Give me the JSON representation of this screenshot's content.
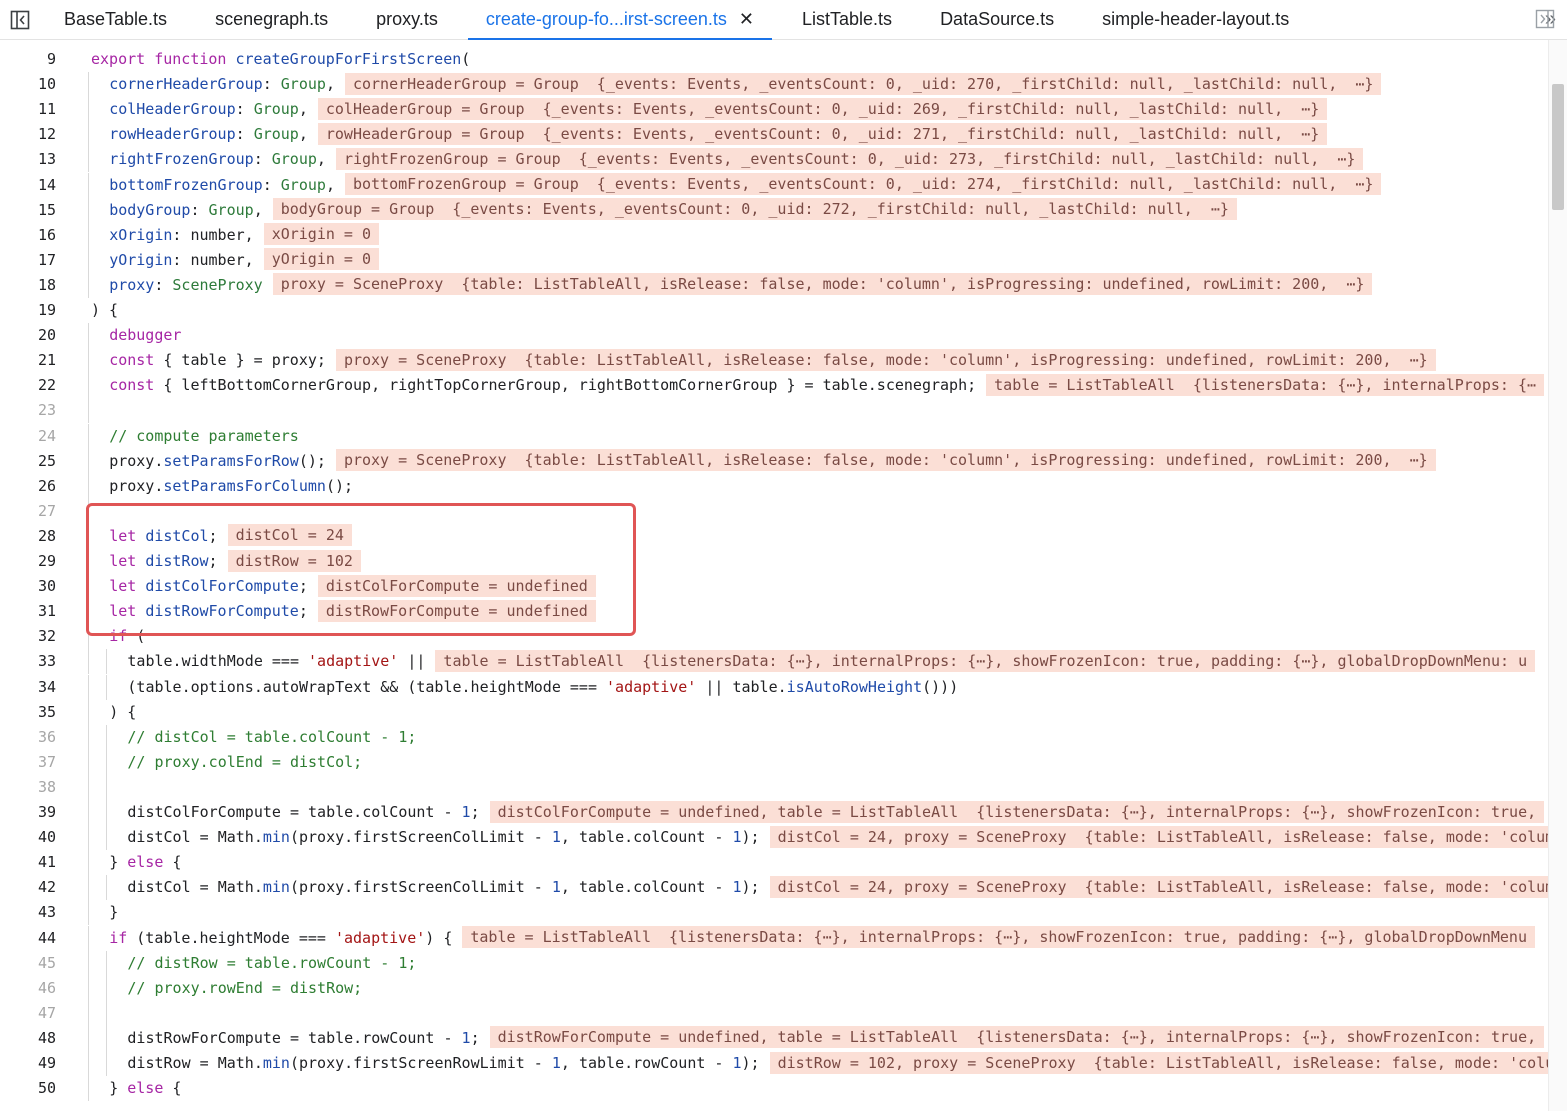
{
  "tabs": [
    {
      "label": "BaseTable.ts",
      "active": false
    },
    {
      "label": "scenegraph.ts",
      "active": false
    },
    {
      "label": "proxy.ts",
      "active": false
    },
    {
      "label": "create-group-fo...irst-screen.ts",
      "active": true
    },
    {
      "label": "ListTable.ts",
      "active": false
    },
    {
      "label": "DataSource.ts",
      "active": false
    },
    {
      "label": "simple-header-layout.ts",
      "active": false
    }
  ],
  "tab_close_glyph": "✕",
  "more_tabs_glyph": "»",
  "colors": {
    "accent": "#1a73e8",
    "inline_value_bg": "#fbdfd6",
    "highlight_box": "#e05555"
  },
  "lines": [
    {
      "n": "9",
      "indent": 0,
      "tokens": [
        [
          "kw",
          "export "
        ],
        [
          "kw",
          "function "
        ],
        [
          "fn",
          "createGroupForFirstScreen"
        ],
        [
          "plain",
          "("
        ]
      ],
      "inline": ""
    },
    {
      "n": "10",
      "indent": 1,
      "tokens": [
        [
          "prop",
          "cornerHeaderGroup"
        ],
        [
          "plain",
          ": "
        ],
        [
          "typ",
          "Group"
        ],
        [
          "plain",
          ","
        ]
      ],
      "inline": "cornerHeaderGroup = Group  {_events: Events, _eventsCount: 0, _uid: 270, _firstChild: null, _lastChild: null,  ⋯}"
    },
    {
      "n": "11",
      "indent": 1,
      "tokens": [
        [
          "prop",
          "colHeaderGroup"
        ],
        [
          "plain",
          ": "
        ],
        [
          "typ",
          "Group"
        ],
        [
          "plain",
          ","
        ]
      ],
      "inline": "colHeaderGroup = Group  {_events: Events, _eventsCount: 0, _uid: 269, _firstChild: null, _lastChild: null,  ⋯}"
    },
    {
      "n": "12",
      "indent": 1,
      "tokens": [
        [
          "prop",
          "rowHeaderGroup"
        ],
        [
          "plain",
          ": "
        ],
        [
          "typ",
          "Group"
        ],
        [
          "plain",
          ","
        ]
      ],
      "inline": "rowHeaderGroup = Group  {_events: Events, _eventsCount: 0, _uid: 271, _firstChild: null, _lastChild: null,  ⋯}"
    },
    {
      "n": "13",
      "indent": 1,
      "tokens": [
        [
          "prop",
          "rightFrozenGroup"
        ],
        [
          "plain",
          ": "
        ],
        [
          "typ",
          "Group"
        ],
        [
          "plain",
          ","
        ]
      ],
      "inline": "rightFrozenGroup = Group  {_events: Events, _eventsCount: 0, _uid: 273, _firstChild: null, _lastChild: null,  ⋯}"
    },
    {
      "n": "14",
      "indent": 1,
      "tokens": [
        [
          "prop",
          "bottomFrozenGroup"
        ],
        [
          "plain",
          ": "
        ],
        [
          "typ",
          "Group"
        ],
        [
          "plain",
          ","
        ]
      ],
      "inline": "bottomFrozenGroup = Group  {_events: Events, _eventsCount: 0, _uid: 274, _firstChild: null, _lastChild: null,  ⋯}"
    },
    {
      "n": "15",
      "indent": 1,
      "tokens": [
        [
          "prop",
          "bodyGroup"
        ],
        [
          "plain",
          ": "
        ],
        [
          "typ",
          "Group"
        ],
        [
          "plain",
          ","
        ]
      ],
      "inline": "bodyGroup = Group  {_events: Events, _eventsCount: 0, _uid: 272, _firstChild: null, _lastChild: null,  ⋯}"
    },
    {
      "n": "16",
      "indent": 1,
      "tokens": [
        [
          "prop",
          "xOrigin"
        ],
        [
          "plain",
          ": number,"
        ]
      ],
      "inline": "xOrigin = 0"
    },
    {
      "n": "17",
      "indent": 1,
      "tokens": [
        [
          "prop",
          "yOrigin"
        ],
        [
          "plain",
          ": number,"
        ]
      ],
      "inline": "yOrigin = 0"
    },
    {
      "n": "18",
      "indent": 1,
      "tokens": [
        [
          "prop",
          "proxy"
        ],
        [
          "plain",
          ": "
        ],
        [
          "typ",
          "SceneProxy"
        ]
      ],
      "inline": "proxy = SceneProxy  {table: ListTableAll, isRelease: false, mode: 'column', isProgressing: undefined, rowLimit: 200,  ⋯}"
    },
    {
      "n": "19",
      "indent": 0,
      "tokens": [
        [
          "plain",
          ") {"
        ]
      ],
      "inline": ""
    },
    {
      "n": "20",
      "indent": 1,
      "tokens": [
        [
          "kw",
          "debugger"
        ]
      ],
      "inline": ""
    },
    {
      "n": "21",
      "indent": 1,
      "tokens": [
        [
          "kw",
          "const "
        ],
        [
          "plain",
          "{ table } = proxy;"
        ]
      ],
      "inline": "proxy = SceneProxy  {table: ListTableAll, isRelease: false, mode: 'column', isProgressing: undefined, rowLimit: 200,  ⋯}"
    },
    {
      "n": "22",
      "indent": 1,
      "tokens": [
        [
          "kw",
          "const "
        ],
        [
          "plain",
          "{ leftBottomCornerGroup, rightTopCornerGroup, rightBottomCornerGroup } = table.scenegraph;"
        ]
      ],
      "inline": "table = ListTableAll  {listenersData: {⋯}, internalProps: {⋯"
    },
    {
      "n": "23",
      "indent": 1,
      "tokens": [],
      "inline": ""
    },
    {
      "n": "24",
      "indent": 1,
      "tokens": [
        [
          "cmt",
          "// compute parameters"
        ]
      ],
      "inline": ""
    },
    {
      "n": "25",
      "indent": 1,
      "tokens": [
        [
          "plain",
          "proxy."
        ],
        [
          "fn",
          "setParamsForRow"
        ],
        [
          "plain",
          "();"
        ]
      ],
      "inline": "proxy = SceneProxy  {table: ListTableAll, isRelease: false, mode: 'column', isProgressing: undefined, rowLimit: 200,  ⋯}"
    },
    {
      "n": "26",
      "indent": 1,
      "tokens": [
        [
          "plain",
          "proxy."
        ],
        [
          "fn",
          "setParamsForColumn"
        ],
        [
          "plain",
          "();"
        ]
      ],
      "inline": ""
    },
    {
      "n": "27",
      "indent": 1,
      "tokens": [],
      "inline": ""
    },
    {
      "n": "28",
      "indent": 1,
      "tokens": [
        [
          "kw",
          "let "
        ],
        [
          "prop",
          "distCol"
        ],
        [
          "plain",
          ";"
        ]
      ],
      "inline": "distCol = 24"
    },
    {
      "n": "29",
      "indent": 1,
      "tokens": [
        [
          "kw",
          "let "
        ],
        [
          "prop",
          "distRow"
        ],
        [
          "plain",
          ";"
        ]
      ],
      "inline": "distRow = 102"
    },
    {
      "n": "30",
      "indent": 1,
      "tokens": [
        [
          "kw",
          "let "
        ],
        [
          "prop",
          "distColForCompute"
        ],
        [
          "plain",
          ";"
        ]
      ],
      "inline": "distColForCompute = undefined"
    },
    {
      "n": "31",
      "indent": 1,
      "tokens": [
        [
          "kw",
          "let "
        ],
        [
          "prop",
          "distRowForCompute"
        ],
        [
          "plain",
          ";"
        ]
      ],
      "inline": "distRowForCompute = undefined"
    },
    {
      "n": "32",
      "indent": 1,
      "tokens": [
        [
          "kw",
          "if "
        ],
        [
          "plain",
          "("
        ]
      ],
      "inline": ""
    },
    {
      "n": "33",
      "indent": 2,
      "tokens": [
        [
          "plain",
          "table.widthMode === "
        ],
        [
          "str",
          "'adaptive'"
        ],
        [
          "plain",
          " ||"
        ]
      ],
      "inline": "table = ListTableAll  {listenersData: {⋯}, internalProps: {⋯}, showFrozenIcon: true, padding: {⋯}, globalDropDownMenu: u"
    },
    {
      "n": "34",
      "indent": 2,
      "tokens": [
        [
          "plain",
          "(table.options.autoWrapText && (table.heightMode === "
        ],
        [
          "str",
          "'adaptive'"
        ],
        [
          "plain",
          " || table."
        ],
        [
          "fn",
          "isAutoRowHeight"
        ],
        [
          "plain",
          "()))"
        ]
      ],
      "inline": ""
    },
    {
      "n": "35",
      "indent": 1,
      "tokens": [
        [
          "plain",
          ") {"
        ]
      ],
      "inline": ""
    },
    {
      "n": "36",
      "indent": 2,
      "tokens": [
        [
          "cmt",
          "// distCol = table.colCount - 1;"
        ]
      ],
      "inline": ""
    },
    {
      "n": "37",
      "indent": 2,
      "tokens": [
        [
          "cmt",
          "// proxy.colEnd = distCol;"
        ]
      ],
      "inline": ""
    },
    {
      "n": "38",
      "indent": 2,
      "tokens": [],
      "inline": ""
    },
    {
      "n": "39",
      "indent": 2,
      "tokens": [
        [
          "plain",
          "distColForCompute = table.colCount - "
        ],
        [
          "num",
          "1"
        ],
        [
          "plain",
          ";"
        ]
      ],
      "inline": "distColForCompute = undefined, table = ListTableAll  {listenersData: {⋯}, internalProps: {⋯}, showFrozenIcon: true,"
    },
    {
      "n": "40",
      "indent": 2,
      "tokens": [
        [
          "plain",
          "distCol = Math."
        ],
        [
          "fn",
          "min"
        ],
        [
          "plain",
          "(proxy.firstScreenColLimit - "
        ],
        [
          "num",
          "1"
        ],
        [
          "plain",
          ", table.colCount - "
        ],
        [
          "num",
          "1"
        ],
        [
          "plain",
          ");"
        ]
      ],
      "inline": "distCol = 24, proxy = SceneProxy  {table: ListTableAll, isRelease: false, mode: 'colum"
    },
    {
      "n": "41",
      "indent": 1,
      "tokens": [
        [
          "plain",
          "} "
        ],
        [
          "kw",
          "else "
        ],
        [
          "plain",
          "{"
        ]
      ],
      "inline": ""
    },
    {
      "n": "42",
      "indent": 2,
      "tokens": [
        [
          "plain",
          "distCol = Math."
        ],
        [
          "fn",
          "min"
        ],
        [
          "plain",
          "(proxy.firstScreenColLimit - "
        ],
        [
          "num",
          "1"
        ],
        [
          "plain",
          ", table.colCount - "
        ],
        [
          "num",
          "1"
        ],
        [
          "plain",
          ");"
        ]
      ],
      "inline": "distCol = 24, proxy = SceneProxy  {table: ListTableAll, isRelease: false, mode: 'colum"
    },
    {
      "n": "43",
      "indent": 1,
      "tokens": [
        [
          "plain",
          "}"
        ]
      ],
      "inline": ""
    },
    {
      "n": "44",
      "indent": 1,
      "tokens": [
        [
          "kw",
          "if "
        ],
        [
          "plain",
          "(table.heightMode === "
        ],
        [
          "str",
          "'adaptive'"
        ],
        [
          "plain",
          ") {"
        ]
      ],
      "inline": "table = ListTableAll  {listenersData: {⋯}, internalProps: {⋯}, showFrozenIcon: true, padding: {⋯}, globalDropDownMenu"
    },
    {
      "n": "45",
      "indent": 2,
      "tokens": [
        [
          "cmt",
          "// distRow = table.rowCount - 1;"
        ]
      ],
      "inline": ""
    },
    {
      "n": "46",
      "indent": 2,
      "tokens": [
        [
          "cmt",
          "// proxy.rowEnd = distRow;"
        ]
      ],
      "inline": ""
    },
    {
      "n": "47",
      "indent": 2,
      "tokens": [],
      "inline": ""
    },
    {
      "n": "48",
      "indent": 2,
      "tokens": [
        [
          "plain",
          "distRowForCompute = table.rowCount - "
        ],
        [
          "num",
          "1"
        ],
        [
          "plain",
          ";"
        ]
      ],
      "inline": "distRowForCompute = undefined, table = ListTableAll  {listenersData: {⋯}, internalProps: {⋯}, showFrozenIcon: true,"
    },
    {
      "n": "49",
      "indent": 2,
      "tokens": [
        [
          "plain",
          "distRow = Math."
        ],
        [
          "fn",
          "min"
        ],
        [
          "plain",
          "(proxy.firstScreenRowLimit - "
        ],
        [
          "num",
          "1"
        ],
        [
          "plain",
          ", table.rowCount - "
        ],
        [
          "num",
          "1"
        ],
        [
          "plain",
          ");"
        ]
      ],
      "inline": "distRow = 102, proxy = SceneProxy  {table: ListTableAll, isRelease: false, mode: 'colu"
    },
    {
      "n": "50",
      "indent": 1,
      "tokens": [
        [
          "plain",
          "} "
        ],
        [
          "kw",
          "else "
        ],
        [
          "plain",
          "{"
        ]
      ],
      "inline": ""
    }
  ],
  "dim_line_numbers": [
    "23",
    "24",
    "27",
    "36",
    "37",
    "38",
    "45",
    "46",
    "47"
  ]
}
